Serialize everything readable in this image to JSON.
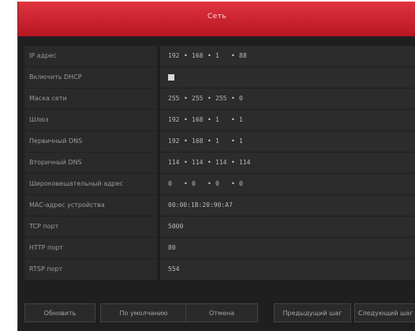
{
  "title": "Сеть",
  "rows": [
    {
      "label": "IP адрес",
      "type": "ip",
      "octets": [
        "192",
        "168",
        "1",
        "88"
      ]
    },
    {
      "label": "Включить DHCP",
      "type": "checkbox",
      "checked": true
    },
    {
      "label": "Маска сети",
      "type": "ip",
      "octets": [
        "255",
        "255",
        "255",
        "0"
      ]
    },
    {
      "label": "Шлюз",
      "type": "ip",
      "octets": [
        "192",
        "168",
        "1",
        "1"
      ]
    },
    {
      "label": "Первичный DNS",
      "type": "ip",
      "octets": [
        "192",
        "168",
        "1",
        "1"
      ]
    },
    {
      "label": "Вторичный DNS",
      "type": "ip",
      "octets": [
        "114",
        "114",
        "114",
        "114"
      ]
    },
    {
      "label": "Широковещательный адрес",
      "type": "ip",
      "octets": [
        "0",
        "0",
        "0",
        "0"
      ]
    },
    {
      "label": "MAC-адрес устройства",
      "type": "text",
      "value": "00:00:1B:20:90:A7"
    },
    {
      "label": "TCP порт",
      "type": "text",
      "value": "5000"
    },
    {
      "label": "HTTP порт",
      "type": "text",
      "value": "80"
    },
    {
      "label": "RTSP порт",
      "type": "text",
      "value": "554"
    }
  ],
  "buttons": {
    "refresh": "Обновить",
    "defaults": "По умолчанию",
    "cancel": "Отмена",
    "prev": "Предыдущий шаг",
    "next": "Следующий шаг"
  },
  "colors": {
    "titlebar": "#d42a35",
    "background": "#1f1f1f",
    "field": "#2c2c2c"
  }
}
